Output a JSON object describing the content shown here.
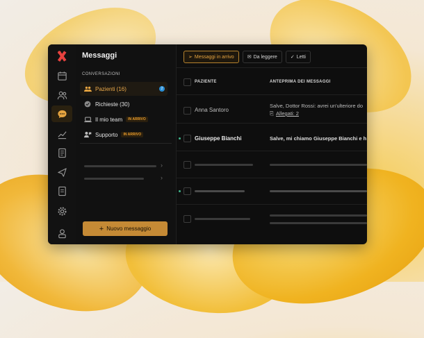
{
  "panel": {
    "title": "Messaggi",
    "section": "CONVERSAZIONI",
    "conversations": [
      {
        "label": "Pazienti (16)",
        "badge": "",
        "count": "2",
        "icon": "people-icon"
      },
      {
        "label": "Richieste (30)",
        "badge": "",
        "icon": "check-circle-icon"
      },
      {
        "label": "Il mio team",
        "badge": "IN ARRIVO",
        "icon": "laptop-icon"
      },
      {
        "label": "Supporto",
        "badge": "IN ARRIVO",
        "icon": "support-icon"
      }
    ],
    "new_message_label": "Nuovo messaggio"
  },
  "tabs": [
    {
      "label": "Messaggi in arrivo",
      "icon": "send-icon"
    },
    {
      "label": "Da leggere",
      "icon": "mail-icon"
    },
    {
      "label": "Letti",
      "icon": "check-icon"
    }
  ],
  "table": {
    "headers": {
      "patient": "PAZIENTE",
      "preview": "ANTEPRIMA DEI MESSAGGI"
    },
    "rows": [
      {
        "patient": "Anna Santoro",
        "preview": "Salve, Dottor Rossi: avrei un'ulteriore do",
        "attachment": "Allegati: 2",
        "unread": false
      },
      {
        "patient": "Giuseppe Bianchi",
        "preview": "Salve, mi chiamo Giuseppe Bianchi e h",
        "unread": true
      }
    ]
  },
  "colors": {
    "accent": "#c58a35",
    "unread": "#3fb48a",
    "count_badge": "#2b8fd6"
  }
}
